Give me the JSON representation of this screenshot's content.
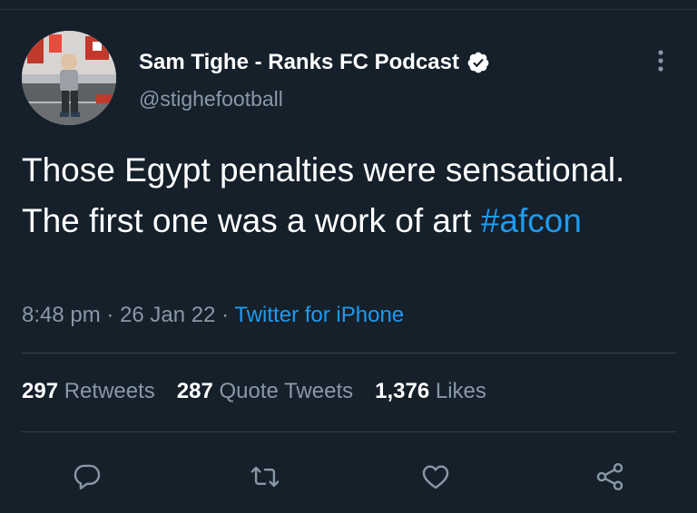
{
  "tweet": {
    "author": {
      "display_name": "Sam Tighe - Ranks FC Podcast",
      "handle": "@stighefootball",
      "verified": true,
      "avatar_icon": "avatar-photo"
    },
    "text_plain": "Those Egypt penalties were sensational. The first one was a work of art ",
    "hashtag": "#afcon",
    "time": "8:48 pm",
    "date": "26 Jan 22",
    "separator": "·",
    "source": "Twitter for iPhone"
  },
  "stats": {
    "retweets": {
      "count": "297",
      "label": "Retweets"
    },
    "quote_tweets": {
      "count": "287",
      "label": "Quote Tweets"
    },
    "likes": {
      "count": "1,376",
      "label": "Likes"
    }
  },
  "actions": [
    {
      "name": "reply",
      "icon": "reply-icon"
    },
    {
      "name": "retweet",
      "icon": "retweet-icon"
    },
    {
      "name": "like",
      "icon": "like-icon"
    },
    {
      "name": "share",
      "icon": "share-icon"
    }
  ],
  "colors": {
    "background": "#15202b",
    "text": "#ffffff",
    "secondary_text": "#8899a6",
    "link": "#1d9bf0",
    "divider": "#38444d"
  }
}
